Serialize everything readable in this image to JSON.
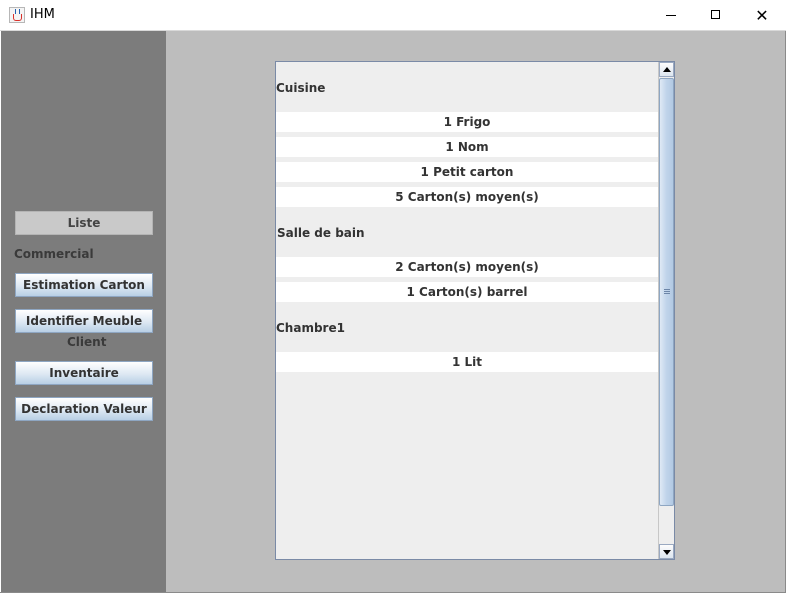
{
  "window": {
    "title": "IHM",
    "close_glyph": "✕",
    "icon": "java-cup-icon"
  },
  "sidebar": {
    "buttons": {
      "liste": "Liste",
      "estimation": "Estimation Carton",
      "identifier": "Identifier Meuble",
      "inventaire": "Inventaire",
      "declaration": "Declaration Valeur"
    },
    "labels": {
      "commercial": "Commercial",
      "client": "Client"
    }
  },
  "inventory": {
    "categories": [
      {
        "name": "Cuisine",
        "items": [
          "1 Frigo",
          "1 Nom",
          "1 Petit carton",
          "5 Carton(s) moyen(s)"
        ]
      },
      {
        "name": "Salle de bain",
        "items": [
          "2 Carton(s) moyen(s)",
          "1 Carton(s) barrel"
        ]
      },
      {
        "name": "Chambre1",
        "items": [
          "1 Lit"
        ]
      }
    ]
  },
  "colors": {
    "sidebar": "#7c7c7c",
    "main_bg": "#bdbdbd",
    "panel_bg": "#eeeeee",
    "button_gradient_end": "#b8cfe5"
  }
}
